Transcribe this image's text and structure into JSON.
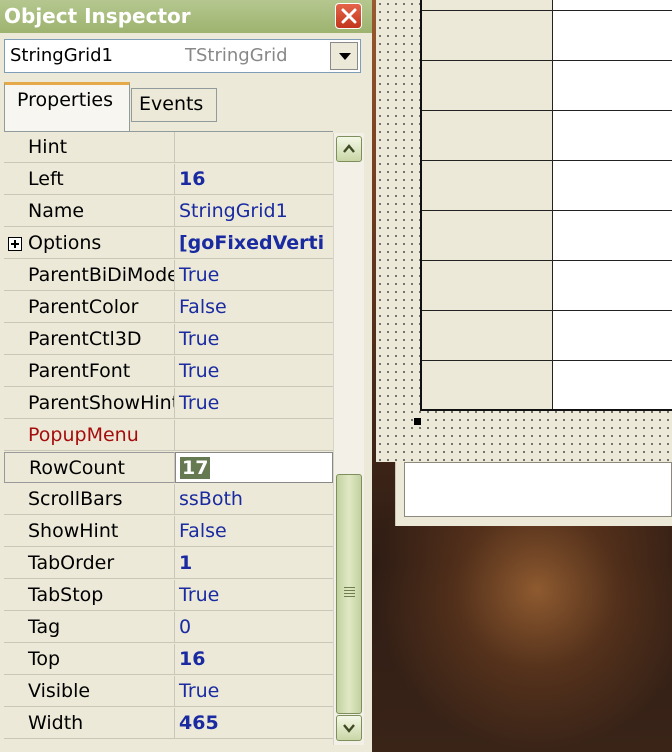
{
  "window": {
    "title": "Object Inspector"
  },
  "component_selector": {
    "name": "StringGrid1",
    "class": "TStringGrid"
  },
  "tabs": [
    {
      "label": "Properties",
      "active": true
    },
    {
      "label": "Events",
      "active": false
    }
  ],
  "properties": [
    {
      "name": "Hint",
      "value": ""
    },
    {
      "name": "Left",
      "value": "16"
    },
    {
      "name": "Name",
      "value": "StringGrid1"
    },
    {
      "name": "Options",
      "value": "[goFixedVerti"
    },
    {
      "name": "ParentBiDiMode",
      "value": "True"
    },
    {
      "name": "ParentColor",
      "value": "False"
    },
    {
      "name": "ParentCtl3D",
      "value": "True"
    },
    {
      "name": "ParentFont",
      "value": "True"
    },
    {
      "name": "ParentShowHint",
      "value": "True"
    },
    {
      "name": "PopupMenu",
      "value": ""
    },
    {
      "name": "RowCount",
      "value": "17"
    },
    {
      "name": "ScrollBars",
      "value": "ssBoth"
    },
    {
      "name": "ShowHint",
      "value": "False"
    },
    {
      "name": "TabOrder",
      "value": "1"
    },
    {
      "name": "TabStop",
      "value": "True"
    },
    {
      "name": "Tag",
      "value": "0"
    },
    {
      "name": "Top",
      "value": "16"
    },
    {
      "name": "Visible",
      "value": "True"
    },
    {
      "name": "Width",
      "value": "465"
    }
  ],
  "colors": {
    "title_bar": "#9db36f",
    "value_text": "#1a2aa0",
    "event_text": "#a50d0d",
    "selection": "#667a52"
  },
  "icons": {
    "close": "close-icon",
    "dropdown": "chevron-down-icon",
    "scroll_up": "scroll-up-icon",
    "scroll_down": "scroll-down-icon",
    "expand": "plus-box-icon"
  }
}
